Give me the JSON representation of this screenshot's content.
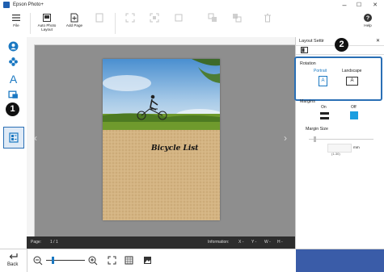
{
  "window": {
    "title": "Epson Photo+",
    "minimize": "–",
    "maximize": "☐",
    "close": "✕"
  },
  "toolbar": {
    "file": "File",
    "auto_photo_layout": "Auto Photo Layout",
    "add_page": "Add Page",
    "help": "Help"
  },
  "sidebar": {
    "text_icon": "A"
  },
  "canvas": {
    "page_title": "Bicycle List",
    "prev_arrow": "‹",
    "next_arrow": "›"
  },
  "status": {
    "page_label": "Page:",
    "page_value": "1 / 1",
    "information_label": "Information:",
    "x_label": "X -",
    "y_label": "Y -",
    "w_label": "W -",
    "h_label": "H -"
  },
  "panel": {
    "title": "Layout Settir",
    "close": "✕",
    "rotation_label": "Rotation",
    "portrait_label": "Portrait",
    "portrait_glyph": "A",
    "landscape_label": "Landscape",
    "landscape_glyph": "A",
    "margins_label": "Margins",
    "on_label": "On",
    "off_label": "Off",
    "margin_size_label": "Margin Size",
    "unit_label": "mm",
    "range_label": "(1-30)"
  },
  "bottom": {
    "back_label": "Back"
  },
  "callouts": {
    "one": "1",
    "two": "2"
  },
  "colors": {
    "accent": "#1a78c2",
    "highlight_border": "#2a6fb5",
    "status_bg": "#2d2d2d",
    "panel_footer": "#3a5ca8"
  }
}
